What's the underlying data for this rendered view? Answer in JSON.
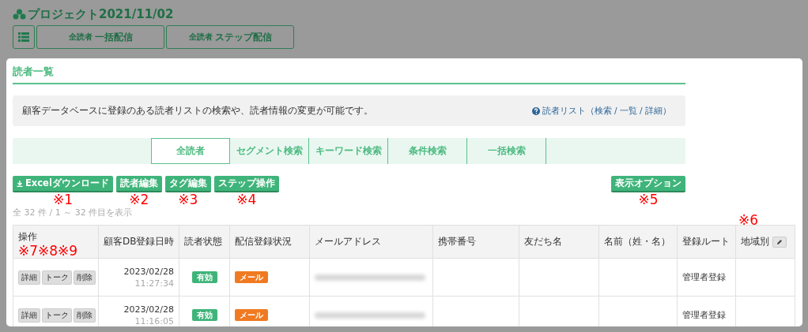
{
  "project": {
    "title": "プロジェクト2021/11/02"
  },
  "top_buttons": [
    {
      "kind": "menu"
    },
    {
      "kind": "text",
      "small": "全読者",
      "label": "一括配信"
    },
    {
      "kind": "text",
      "small": "全読者",
      "label": "ステップ配信"
    }
  ],
  "panel": {
    "title": "読者一覧",
    "info": {
      "text": "顧客データベースに登録のある読者リストの検索や、読者情報の変更が可能です。",
      "help_link": "読者リスト（検索 / 一覧 / 詳細）"
    },
    "tabs": [
      {
        "label": "全読者",
        "selected": true
      },
      {
        "label": "セグメント検索",
        "selected": false
      },
      {
        "label": "キーワード検索",
        "selected": false
      },
      {
        "label": "条件検索",
        "selected": false
      },
      {
        "label": "一括検索",
        "selected": false
      }
    ],
    "actions": [
      {
        "kind": "download",
        "label": "Excelダウンロード",
        "note": "※1"
      },
      {
        "kind": "plain",
        "label": "読者編集",
        "note": "※2"
      },
      {
        "kind": "plain",
        "label": "タグ編集",
        "note": "※3"
      },
      {
        "kind": "plain",
        "label": "ステップ操作",
        "note": "※4"
      }
    ],
    "options_button": {
      "label": "表示オプション",
      "note": "※5"
    },
    "count": "全 32 件 / 1 ～ 32 件目を表示",
    "table": {
      "columns": [
        {
          "label": "操作",
          "note": "※7※8※9"
        },
        {
          "label": "顧客DB登録日時"
        },
        {
          "label": "読者状態"
        },
        {
          "label": "配信登録状況"
        },
        {
          "label": "メールアドレス"
        },
        {
          "label": "携帯番号"
        },
        {
          "label": "友だち名"
        },
        {
          "label": "名前（姓・名）"
        },
        {
          "label": "登録ルート"
        },
        {
          "label": "地域別",
          "edit": true,
          "note": "※6"
        }
      ],
      "rows": [
        {
          "ops": [
            "詳細",
            "トーク",
            "削除"
          ],
          "date": "2023/02/28",
          "time": "11:27:34",
          "status": "有効",
          "delivery": "メール",
          "email_blurred": true,
          "route": "管理者登録"
        },
        {
          "ops": [
            "詳細",
            "トーク",
            "削除"
          ],
          "date": "2023/02/28",
          "time": "11:16:05",
          "status": "有効",
          "delivery": "メール",
          "email_blurred": true,
          "route": "管理者登録"
        }
      ]
    }
  }
}
